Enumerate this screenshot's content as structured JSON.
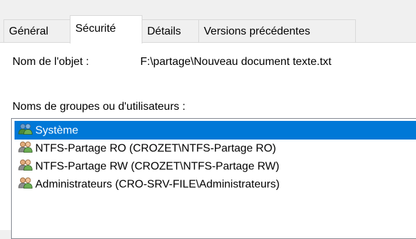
{
  "tabs": [
    {
      "label": "Général",
      "active": false
    },
    {
      "label": "Sécurité",
      "active": true
    },
    {
      "label": "Détails",
      "active": false
    },
    {
      "label": "Versions précédentes",
      "active": false
    }
  ],
  "object": {
    "label": "Nom de l'objet :",
    "value": "F:\\partage\\Nouveau document texte.txt"
  },
  "groups": {
    "label": "Noms de groupes ou d'utilisateurs :",
    "items": [
      {
        "label": "Système",
        "icon": "users-icon",
        "selected": true
      },
      {
        "label": "NTFS-Partage RO (CROZET\\NTFS-Partage RO)",
        "icon": "users-icon",
        "selected": false
      },
      {
        "label": "NTFS-Partage RW (CROZET\\NTFS-Partage RW)",
        "icon": "users-icon",
        "selected": false
      },
      {
        "label": "Administrateurs (CRO-SRV-FILE\\Administrateurs)",
        "icon": "users-icon",
        "selected": false
      }
    ]
  },
  "colors": {
    "selection": "#0078d7",
    "window_bg": "#f0f0f0",
    "content_bg": "#ffffff",
    "border": "#d9d9d9"
  }
}
